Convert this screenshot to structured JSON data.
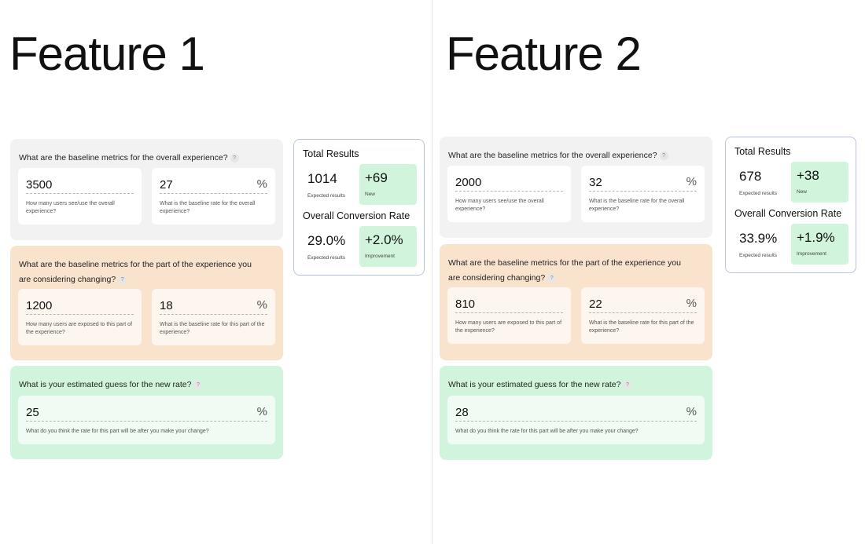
{
  "features": [
    {
      "title": "Feature 1",
      "overall": {
        "question": "What are the baseline metrics for the overall experience?",
        "users_value": "3500",
        "users_help": "How many users see/use the overall experience?",
        "rate_value": "27",
        "rate_unit": "%",
        "rate_help": "What is the baseline rate for the overall experience?"
      },
      "part": {
        "question": "What are the baseline metrics for the part of the experience you are considering changing?",
        "users_value": "1200",
        "users_help": "How many users are exposed to this part of the experience?",
        "rate_value": "18",
        "rate_unit": "%",
        "rate_help": "What is the baseline rate for this part of the experience?"
      },
      "guess": {
        "question": "What is your estimated guess for the new rate?",
        "rate_value": "25",
        "rate_unit": "%",
        "rate_help": "What do you think the rate for this part will be after you make your change?"
      },
      "results": {
        "total_heading": "Total Results",
        "expected_results": "1014",
        "expected_results_label": "Expected results",
        "new_value": "+69",
        "new_label": "New",
        "conversion_heading": "Overall Conversion Rate",
        "expected_rate": "29.0%",
        "expected_rate_label": "Expected results",
        "improvement_value": "+2.0%",
        "improvement_label": "Improvement"
      }
    },
    {
      "title": "Feature 2",
      "overall": {
        "question": "What are the baseline metrics for the overall experience?",
        "users_value": "2000",
        "users_help": "How many users see/use the overall experience?",
        "rate_value": "32",
        "rate_unit": "%",
        "rate_help": "What is the baseline rate for the overall experience?"
      },
      "part": {
        "question": "What are the baseline metrics for the part of the experience you are considering changing?",
        "users_value": "810",
        "users_help": "How many users are exposed to this part of the experience?",
        "rate_value": "22",
        "rate_unit": "%",
        "rate_help": "What is the baseline rate for this part of the experience?"
      },
      "guess": {
        "question": "What is your estimated guess for the new rate?",
        "rate_value": "28",
        "rate_unit": "%",
        "rate_help": "What do you think the rate for this part will be after you make your change?"
      },
      "results": {
        "total_heading": "Total Results",
        "expected_results": "678",
        "expected_results_label": "Expected results",
        "new_value": "+38",
        "new_label": "New",
        "conversion_heading": "Overall Conversion Rate",
        "expected_rate": "33.9%",
        "expected_rate_label": "Expected results",
        "improvement_value": "+1.9%",
        "improvement_label": "Improvement"
      }
    }
  ],
  "help_icon": {
    "icon": "question-mark-icon",
    "glyph": "?"
  },
  "colors": {
    "overall_section": "#f2f2f2",
    "part_section": "#f9e3cd",
    "guess_section": "#d1f5dc",
    "result_highlight": "#d1f5dc",
    "results_border": "#b9c3d8"
  }
}
